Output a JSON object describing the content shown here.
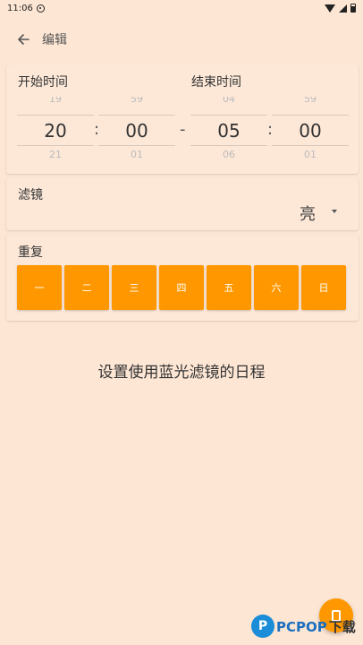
{
  "status_bar": {
    "time": "11:06"
  },
  "app_bar": {
    "back_icon": "arrow-left-icon",
    "title": "编辑"
  },
  "time_card": {
    "start_label": "开始时间",
    "end_label": "结束时间",
    "separator": "-",
    "colon": ":",
    "start_hour": {
      "prev": "19",
      "value": "20",
      "next": "21"
    },
    "start_minute": {
      "prev": "59",
      "value": "00",
      "next": "01"
    },
    "end_hour": {
      "prev": "04",
      "value": "05",
      "next": "06"
    },
    "end_minute": {
      "prev": "59",
      "value": "00",
      "next": "01"
    }
  },
  "filter_card": {
    "label": "滤镜",
    "value": "亮",
    "dropdown_icon": "triangle-down-icon"
  },
  "repeat_card": {
    "label": "重复",
    "days": [
      "一",
      "二",
      "三",
      "四",
      "五",
      "六",
      "日"
    ],
    "day_color": "#ff9800"
  },
  "hint": "设置使用蓝光滤镜的日程",
  "fab": {
    "icon": "save-icon",
    "color": "#ff9800"
  },
  "watermark": {
    "logo": "P",
    "brand": "PCPOP",
    "suffix": "下载"
  },
  "colors": {
    "background": "#fde6d4",
    "accent": "#ff9800"
  }
}
